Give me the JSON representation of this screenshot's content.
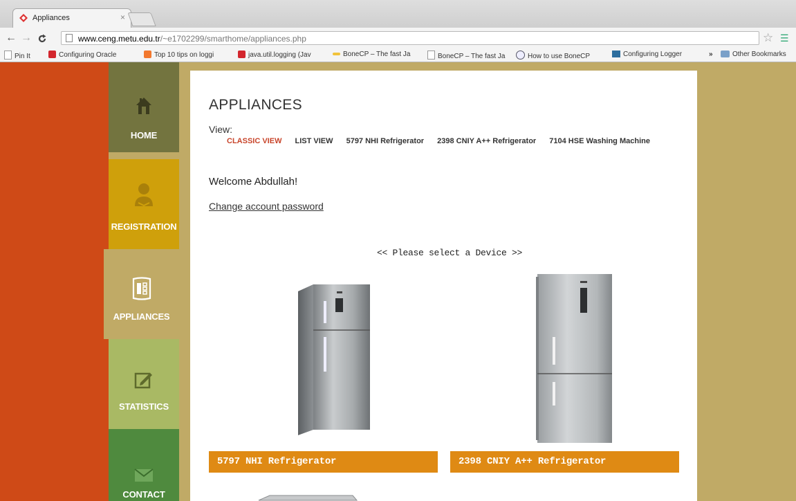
{
  "browser": {
    "tab_title": "Appliances",
    "tab_close": "×",
    "url_host": "www.ceng.metu.edu.tr",
    "url_path": "/~e1702299/smarthome/appliances.php",
    "bookmarks": [
      "Pin It",
      "Configuring Oracle",
      "Top 10 tips on loggi",
      "java.util.logging (Jav",
      "BoneCP – The fast Ja",
      "BoneCP – The fast Ja",
      "How to use BoneCP",
      "Configuring Logger",
      "»",
      "Other Bookmarks"
    ]
  },
  "nav": {
    "home": "HOME",
    "registration": "REGISTRATION",
    "appliances": "APPLIANCES",
    "statistics": "STATISTICS",
    "contact": "CONTACT"
  },
  "colors": {
    "left_strip": "#cf4a17",
    "home": "#73743f",
    "registration": "#cfa00b",
    "appliances": "#c0aa66",
    "statistics": "#a9b964",
    "contact": "#4f8a3e",
    "caption": "#df8a14",
    "active_link": "#c8442a"
  },
  "main": {
    "title": "APPLIANCES",
    "view_label": "View:",
    "view_links": [
      "CLASSIC VIEW",
      "LIST VIEW",
      "5797 NHI Refrigerator",
      "2398 CNIY A++ Refrigerator",
      "7104 HSE Washing Machine"
    ],
    "welcome": "Welcome Abdullah!",
    "change_password": "Change account password",
    "select_prompt": "<< Please select a Device >>",
    "devices": [
      {
        "name": "5797 NHI Refrigerator"
      },
      {
        "name": "2398 CNIY A++ Refrigerator"
      }
    ]
  }
}
